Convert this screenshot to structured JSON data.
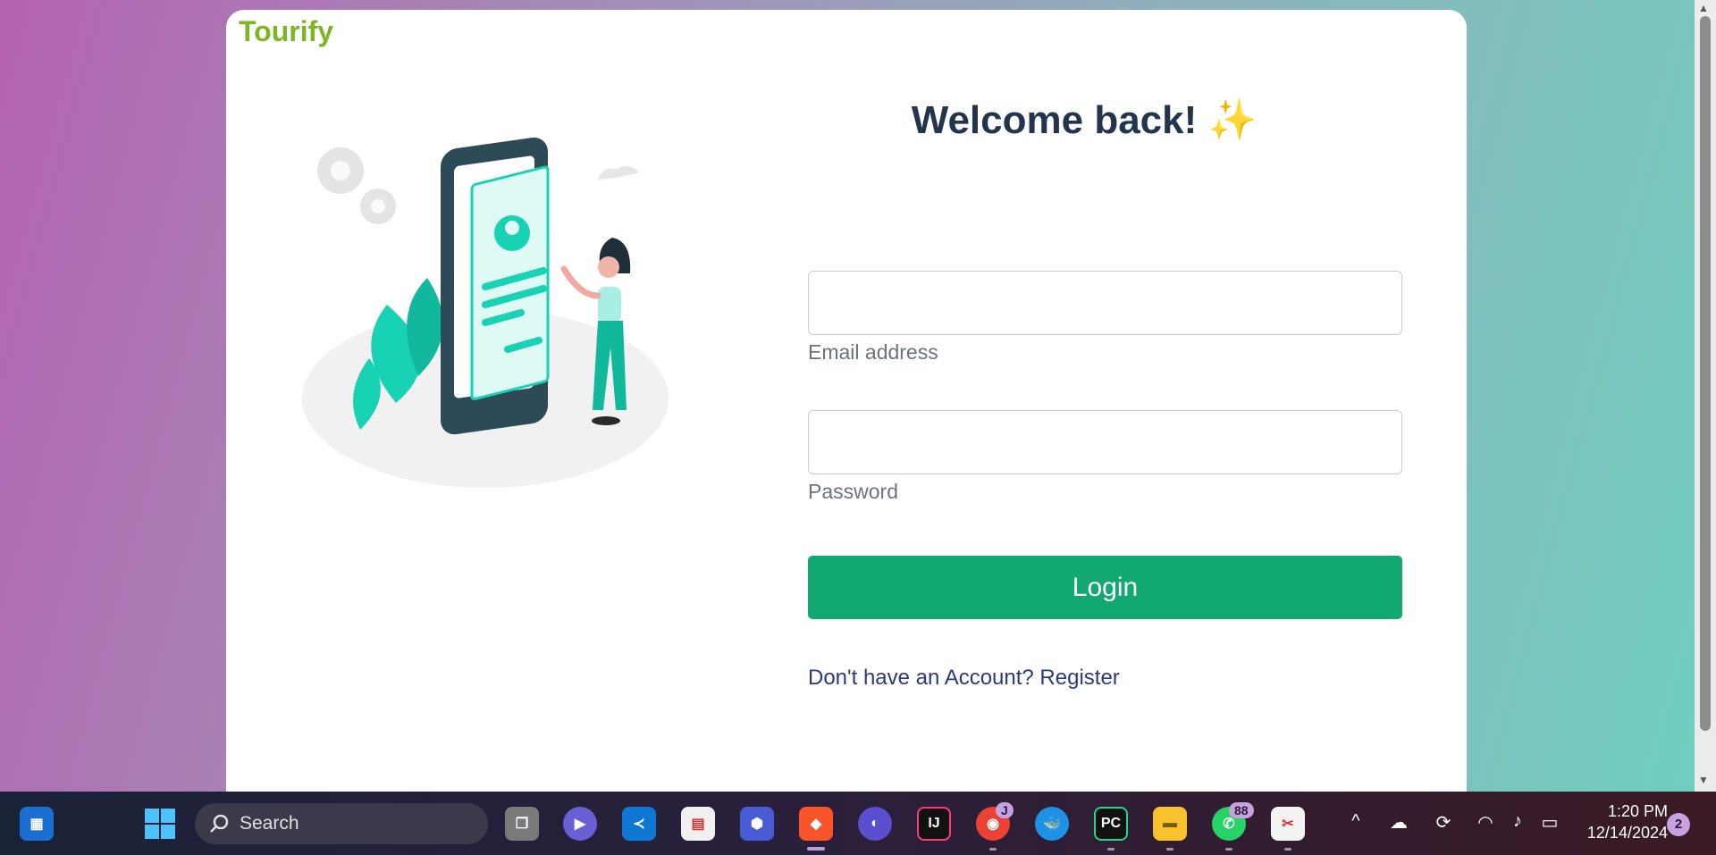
{
  "app": {
    "brand": "Tourify"
  },
  "login": {
    "title": "Welcome back! ✨",
    "email_label": "Email address",
    "email_value": "",
    "password_label": "Password",
    "password_value": "",
    "login_label": "Login",
    "register_text": "Don't have an Account? Register"
  },
  "taskbar": {
    "search_placeholder": "Search",
    "chrome_badge": "J",
    "whatsapp_badge": "88",
    "time": "1:20 PM",
    "date": "12/14/2024",
    "notifications": "2"
  },
  "colors": {
    "brand": "#7cb526",
    "title": "#23344d",
    "button": "#12a872",
    "link": "#2e3a78",
    "illustration_accent": "#17d3b4"
  }
}
